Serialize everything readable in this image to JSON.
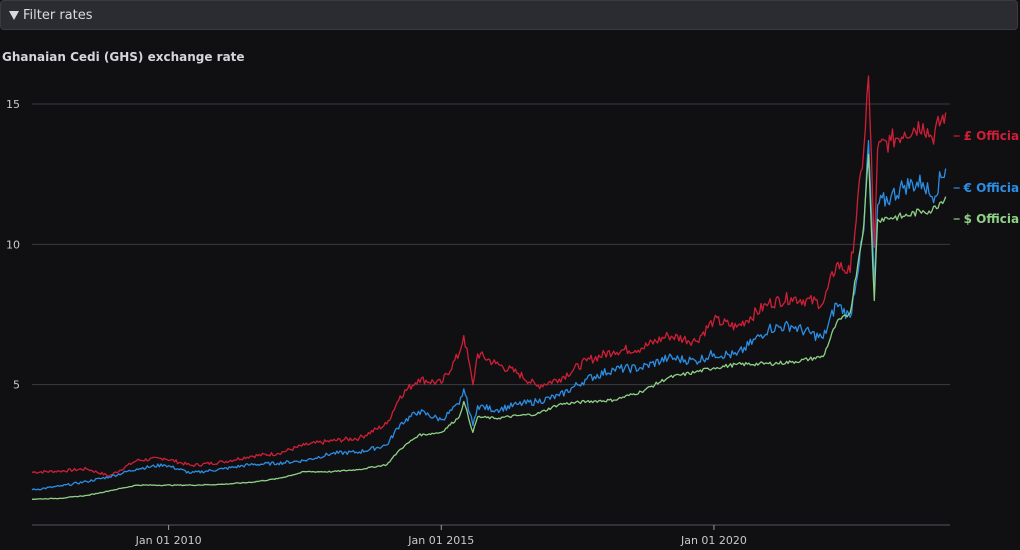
{
  "filter": {
    "label": "Filter rates"
  },
  "chart_data": {
    "type": "line",
    "title": "Ghanaian Cedi (GHS) exchange rate",
    "xlabel": "",
    "ylabel": "",
    "xlim": [
      "2007-07-01",
      "2024-04-30"
    ],
    "ylim": [
      0,
      15.5
    ],
    "grid": true,
    "legend": "inline-right",
    "yticks": [
      5,
      10,
      15
    ],
    "xticks": [
      {
        "date": "2010-01-01",
        "label": "Jan 01 2010"
      },
      {
        "date": "2015-01-01",
        "label": "Jan 01 2015"
      },
      {
        "date": "2020-01-01",
        "label": "Jan 01 2020"
      }
    ],
    "series": [
      {
        "name": "£ Official",
        "color": "#cf1f36",
        "points": [
          [
            "2007-07-01",
            1.88
          ],
          [
            "2008-01-01",
            1.92
          ],
          [
            "2008-07-01",
            2.0
          ],
          [
            "2008-12-01",
            1.75
          ],
          [
            "2009-06-01",
            2.3
          ],
          [
            "2009-12-01",
            2.38
          ],
          [
            "2010-06-01",
            2.12
          ],
          [
            "2011-01-01",
            2.25
          ],
          [
            "2011-07-01",
            2.45
          ],
          [
            "2012-01-01",
            2.55
          ],
          [
            "2012-07-01",
            2.85
          ],
          [
            "2013-01-01",
            3.0
          ],
          [
            "2013-07-01",
            3.1
          ],
          [
            "2014-01-01",
            3.6
          ],
          [
            "2014-04-01",
            4.6
          ],
          [
            "2014-08-01",
            5.2
          ],
          [
            "2015-01-01",
            5.05
          ],
          [
            "2015-05-01",
            6.1
          ],
          [
            "2015-06-01",
            6.75
          ],
          [
            "2015-08-01",
            5.0
          ],
          [
            "2015-09-01",
            6.1
          ],
          [
            "2016-01-01",
            5.75
          ],
          [
            "2016-06-01",
            5.4
          ],
          [
            "2016-10-01",
            4.95
          ],
          [
            "2017-03-01",
            5.2
          ],
          [
            "2017-09-01",
            5.85
          ],
          [
            "2018-03-01",
            6.2
          ],
          [
            "2018-09-01",
            6.3
          ],
          [
            "2019-03-01",
            6.75
          ],
          [
            "2019-09-01",
            6.55
          ],
          [
            "2020-01-01",
            7.3
          ],
          [
            "2020-06-01",
            7.05
          ],
          [
            "2021-01-01",
            7.9
          ],
          [
            "2021-06-01",
            8.1
          ],
          [
            "2022-01-01",
            7.9
          ],
          [
            "2022-04-01",
            9.3
          ],
          [
            "2022-07-01",
            9.0
          ],
          [
            "2022-10-01",
            13.4
          ],
          [
            "2022-11-01",
            16.0
          ],
          [
            "2022-12-10",
            9.9
          ],
          [
            "2023-01-01",
            13.4
          ],
          [
            "2023-04-01",
            13.7
          ],
          [
            "2023-07-01",
            14.0
          ],
          [
            "2023-11-01",
            14.3
          ],
          [
            "2024-01-01",
            13.8
          ],
          [
            "2024-04-01",
            14.7
          ]
        ]
      },
      {
        "name": "€ Official",
        "color": "#2b8de3",
        "points": [
          [
            "2007-07-01",
            1.25
          ],
          [
            "2008-01-01",
            1.38
          ],
          [
            "2008-07-01",
            1.55
          ],
          [
            "2008-12-01",
            1.72
          ],
          [
            "2009-06-01",
            2.0
          ],
          [
            "2009-12-01",
            2.15
          ],
          [
            "2010-06-01",
            1.85
          ],
          [
            "2011-01-01",
            2.0
          ],
          [
            "2011-07-01",
            2.15
          ],
          [
            "2012-01-01",
            2.2
          ],
          [
            "2012-07-01",
            2.3
          ],
          [
            "2013-01-01",
            2.55
          ],
          [
            "2013-07-01",
            2.6
          ],
          [
            "2014-01-01",
            2.85
          ],
          [
            "2014-04-01",
            3.6
          ],
          [
            "2014-08-01",
            4.05
          ],
          [
            "2015-01-01",
            3.75
          ],
          [
            "2015-05-01",
            4.3
          ],
          [
            "2015-06-01",
            4.85
          ],
          [
            "2015-08-01",
            3.55
          ],
          [
            "2015-09-01",
            4.25
          ],
          [
            "2016-01-01",
            4.1
          ],
          [
            "2016-06-01",
            4.3
          ],
          [
            "2016-10-01",
            4.4
          ],
          [
            "2017-03-01",
            4.6
          ],
          [
            "2017-09-01",
            5.2
          ],
          [
            "2018-03-01",
            5.55
          ],
          [
            "2018-09-01",
            5.6
          ],
          [
            "2019-03-01",
            5.95
          ],
          [
            "2019-09-01",
            5.85
          ],
          [
            "2020-01-01",
            6.1
          ],
          [
            "2020-06-01",
            6.05
          ],
          [
            "2021-01-01",
            7.0
          ],
          [
            "2021-06-01",
            7.1
          ],
          [
            "2022-01-01",
            6.65
          ],
          [
            "2022-04-01",
            7.9
          ],
          [
            "2022-07-01",
            7.4
          ],
          [
            "2022-10-01",
            10.5
          ],
          [
            "2022-11-01",
            13.7
          ],
          [
            "2022-12-10",
            8.5
          ],
          [
            "2023-01-01",
            11.4
          ],
          [
            "2023-04-01",
            11.7
          ],
          [
            "2023-07-01",
            12.1
          ],
          [
            "2023-11-01",
            12.2
          ],
          [
            "2024-01-01",
            11.7
          ],
          [
            "2024-04-01",
            12.7
          ]
        ]
      },
      {
        "name": "$ Official",
        "color": "#8fcf86",
        "points": [
          [
            "2007-07-01",
            0.92
          ],
          [
            "2008-01-01",
            0.95
          ],
          [
            "2008-07-01",
            1.05
          ],
          [
            "2008-12-01",
            1.22
          ],
          [
            "2009-06-01",
            1.42
          ],
          [
            "2009-12-01",
            1.42
          ],
          [
            "2010-06-01",
            1.42
          ],
          [
            "2011-01-01",
            1.45
          ],
          [
            "2011-07-01",
            1.52
          ],
          [
            "2012-01-01",
            1.65
          ],
          [
            "2012-07-01",
            1.9
          ],
          [
            "2013-01-01",
            1.9
          ],
          [
            "2013-07-01",
            1.98
          ],
          [
            "2014-01-01",
            2.15
          ],
          [
            "2014-04-01",
            2.7
          ],
          [
            "2014-08-01",
            3.2
          ],
          [
            "2015-01-01",
            3.3
          ],
          [
            "2015-05-01",
            3.85
          ],
          [
            "2015-06-01",
            4.4
          ],
          [
            "2015-08-01",
            3.3
          ],
          [
            "2015-09-01",
            3.85
          ],
          [
            "2016-01-01",
            3.8
          ],
          [
            "2016-06-01",
            3.9
          ],
          [
            "2016-10-01",
            3.95
          ],
          [
            "2017-03-01",
            4.3
          ],
          [
            "2017-09-01",
            4.4
          ],
          [
            "2018-03-01",
            4.45
          ],
          [
            "2018-09-01",
            4.75
          ],
          [
            "2019-03-01",
            5.25
          ],
          [
            "2019-09-01",
            5.45
          ],
          [
            "2020-01-01",
            5.6
          ],
          [
            "2020-06-01",
            5.72
          ],
          [
            "2021-01-01",
            5.75
          ],
          [
            "2021-06-01",
            5.8
          ],
          [
            "2022-01-01",
            6.0
          ],
          [
            "2022-04-01",
            7.2
          ],
          [
            "2022-07-01",
            7.55
          ],
          [
            "2022-10-01",
            10.7
          ],
          [
            "2022-11-01",
            13.2
          ],
          [
            "2022-12-10",
            8.0
          ],
          [
            "2023-01-01",
            10.9
          ],
          [
            "2023-04-01",
            10.95
          ],
          [
            "2023-07-01",
            11.0
          ],
          [
            "2023-11-01",
            11.2
          ],
          [
            "2024-01-01",
            11.2
          ],
          [
            "2024-04-01",
            11.7
          ]
        ]
      }
    ]
  }
}
